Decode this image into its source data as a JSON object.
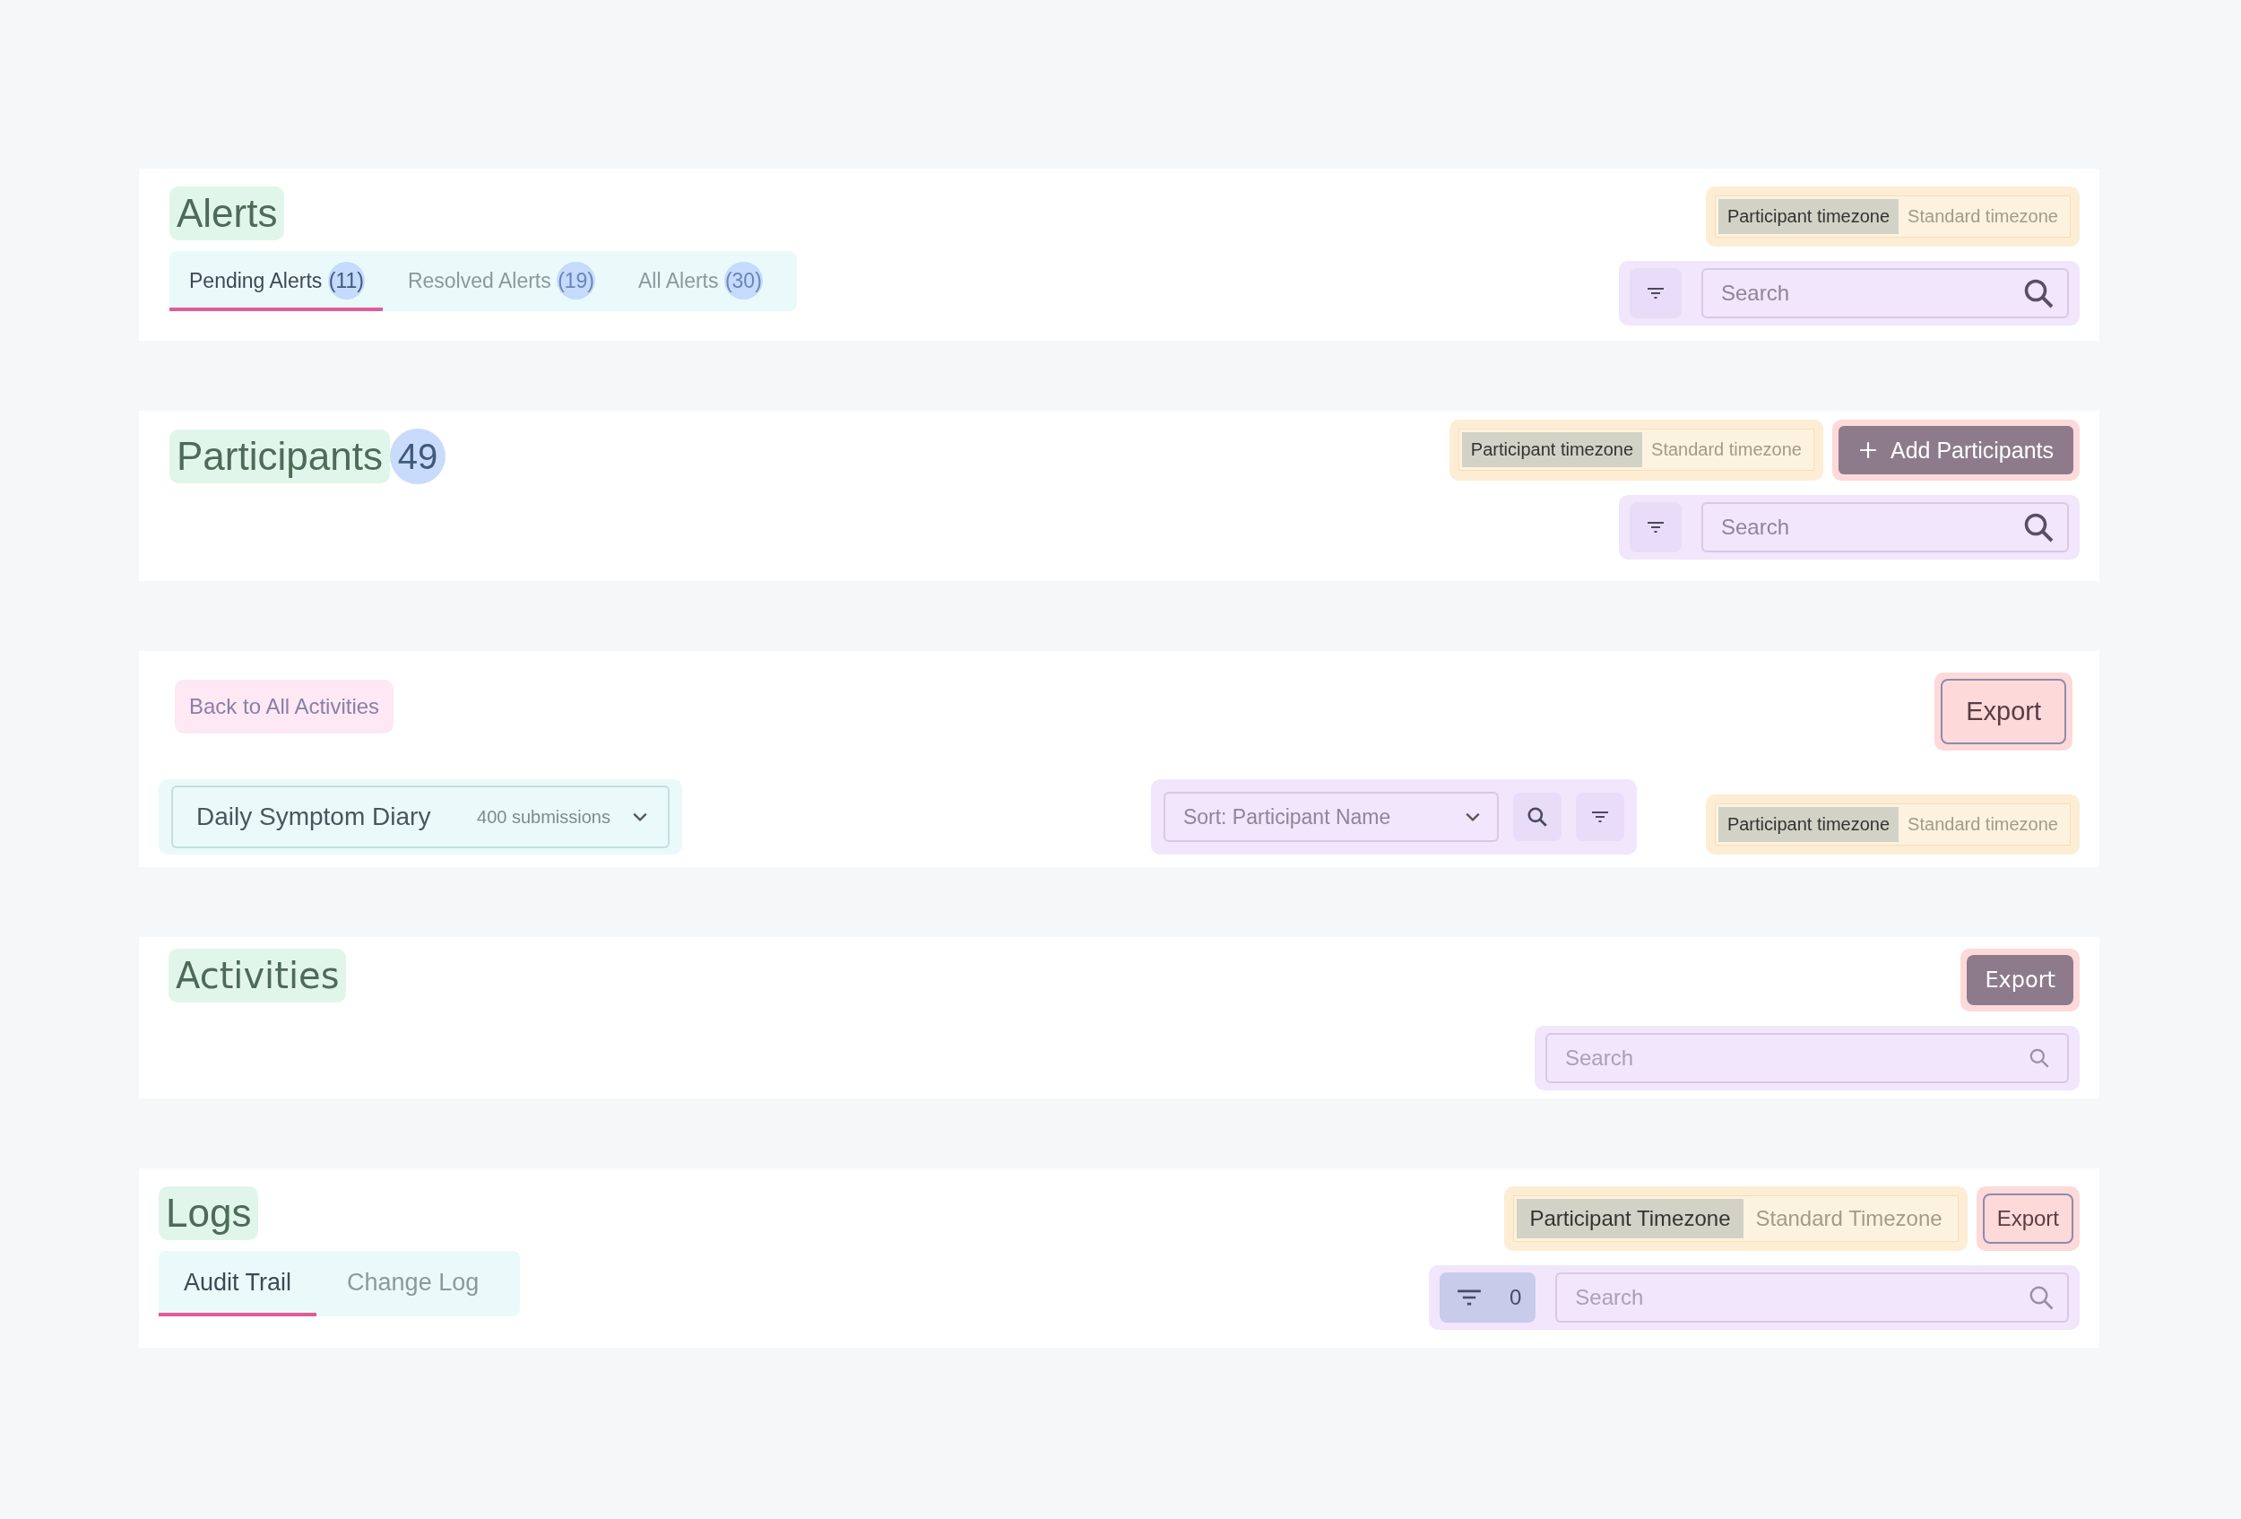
{
  "alerts": {
    "title": "Alerts",
    "timezone": [
      {
        "label": "Participant timezone",
        "selected": true
      },
      {
        "label": "Standard timezone",
        "selected": false
      }
    ],
    "tabs": [
      {
        "label": "Pending Alerts",
        "count": "(11)",
        "selected": true
      },
      {
        "label": "Resolved Alerts",
        "count": "(19)",
        "selected": false
      },
      {
        "label": "All Alerts",
        "count": "(30)",
        "selected": false
      }
    ],
    "search": {
      "placeholder": "Search"
    }
  },
  "participants": {
    "title": "Participants",
    "count": "49",
    "timezone": [
      {
        "label": "Participant timezone",
        "selected": true
      },
      {
        "label": "Standard timezone",
        "selected": false
      }
    ],
    "add_button": "Add Participants",
    "search": {
      "placeholder": "Search"
    }
  },
  "activity_detail": {
    "back_link": "Back to All Activities",
    "export_button": "Export",
    "activity_select": {
      "value": "Daily Symptom Diary",
      "meta": "400 submissions"
    },
    "sort_select": {
      "value": "Sort: Participant Name"
    },
    "timezone": [
      {
        "label": "Participant timezone",
        "selected": true
      },
      {
        "label": "Standard timezone",
        "selected": false
      }
    ]
  },
  "activities": {
    "title": "Activities",
    "export_button": "Export",
    "search": {
      "placeholder": "Search"
    }
  },
  "logs": {
    "title": "Logs",
    "timezone": [
      {
        "label": "Participant Timezone",
        "selected": true
      },
      {
        "label": "Standard Timezone",
        "selected": false
      }
    ],
    "export_button": "Export",
    "tabs": [
      {
        "label": "Audit Trail",
        "selected": true
      },
      {
        "label": "Change Log",
        "selected": false
      }
    ],
    "filter_count": "0",
    "search": {
      "placeholder": "Search"
    }
  }
}
